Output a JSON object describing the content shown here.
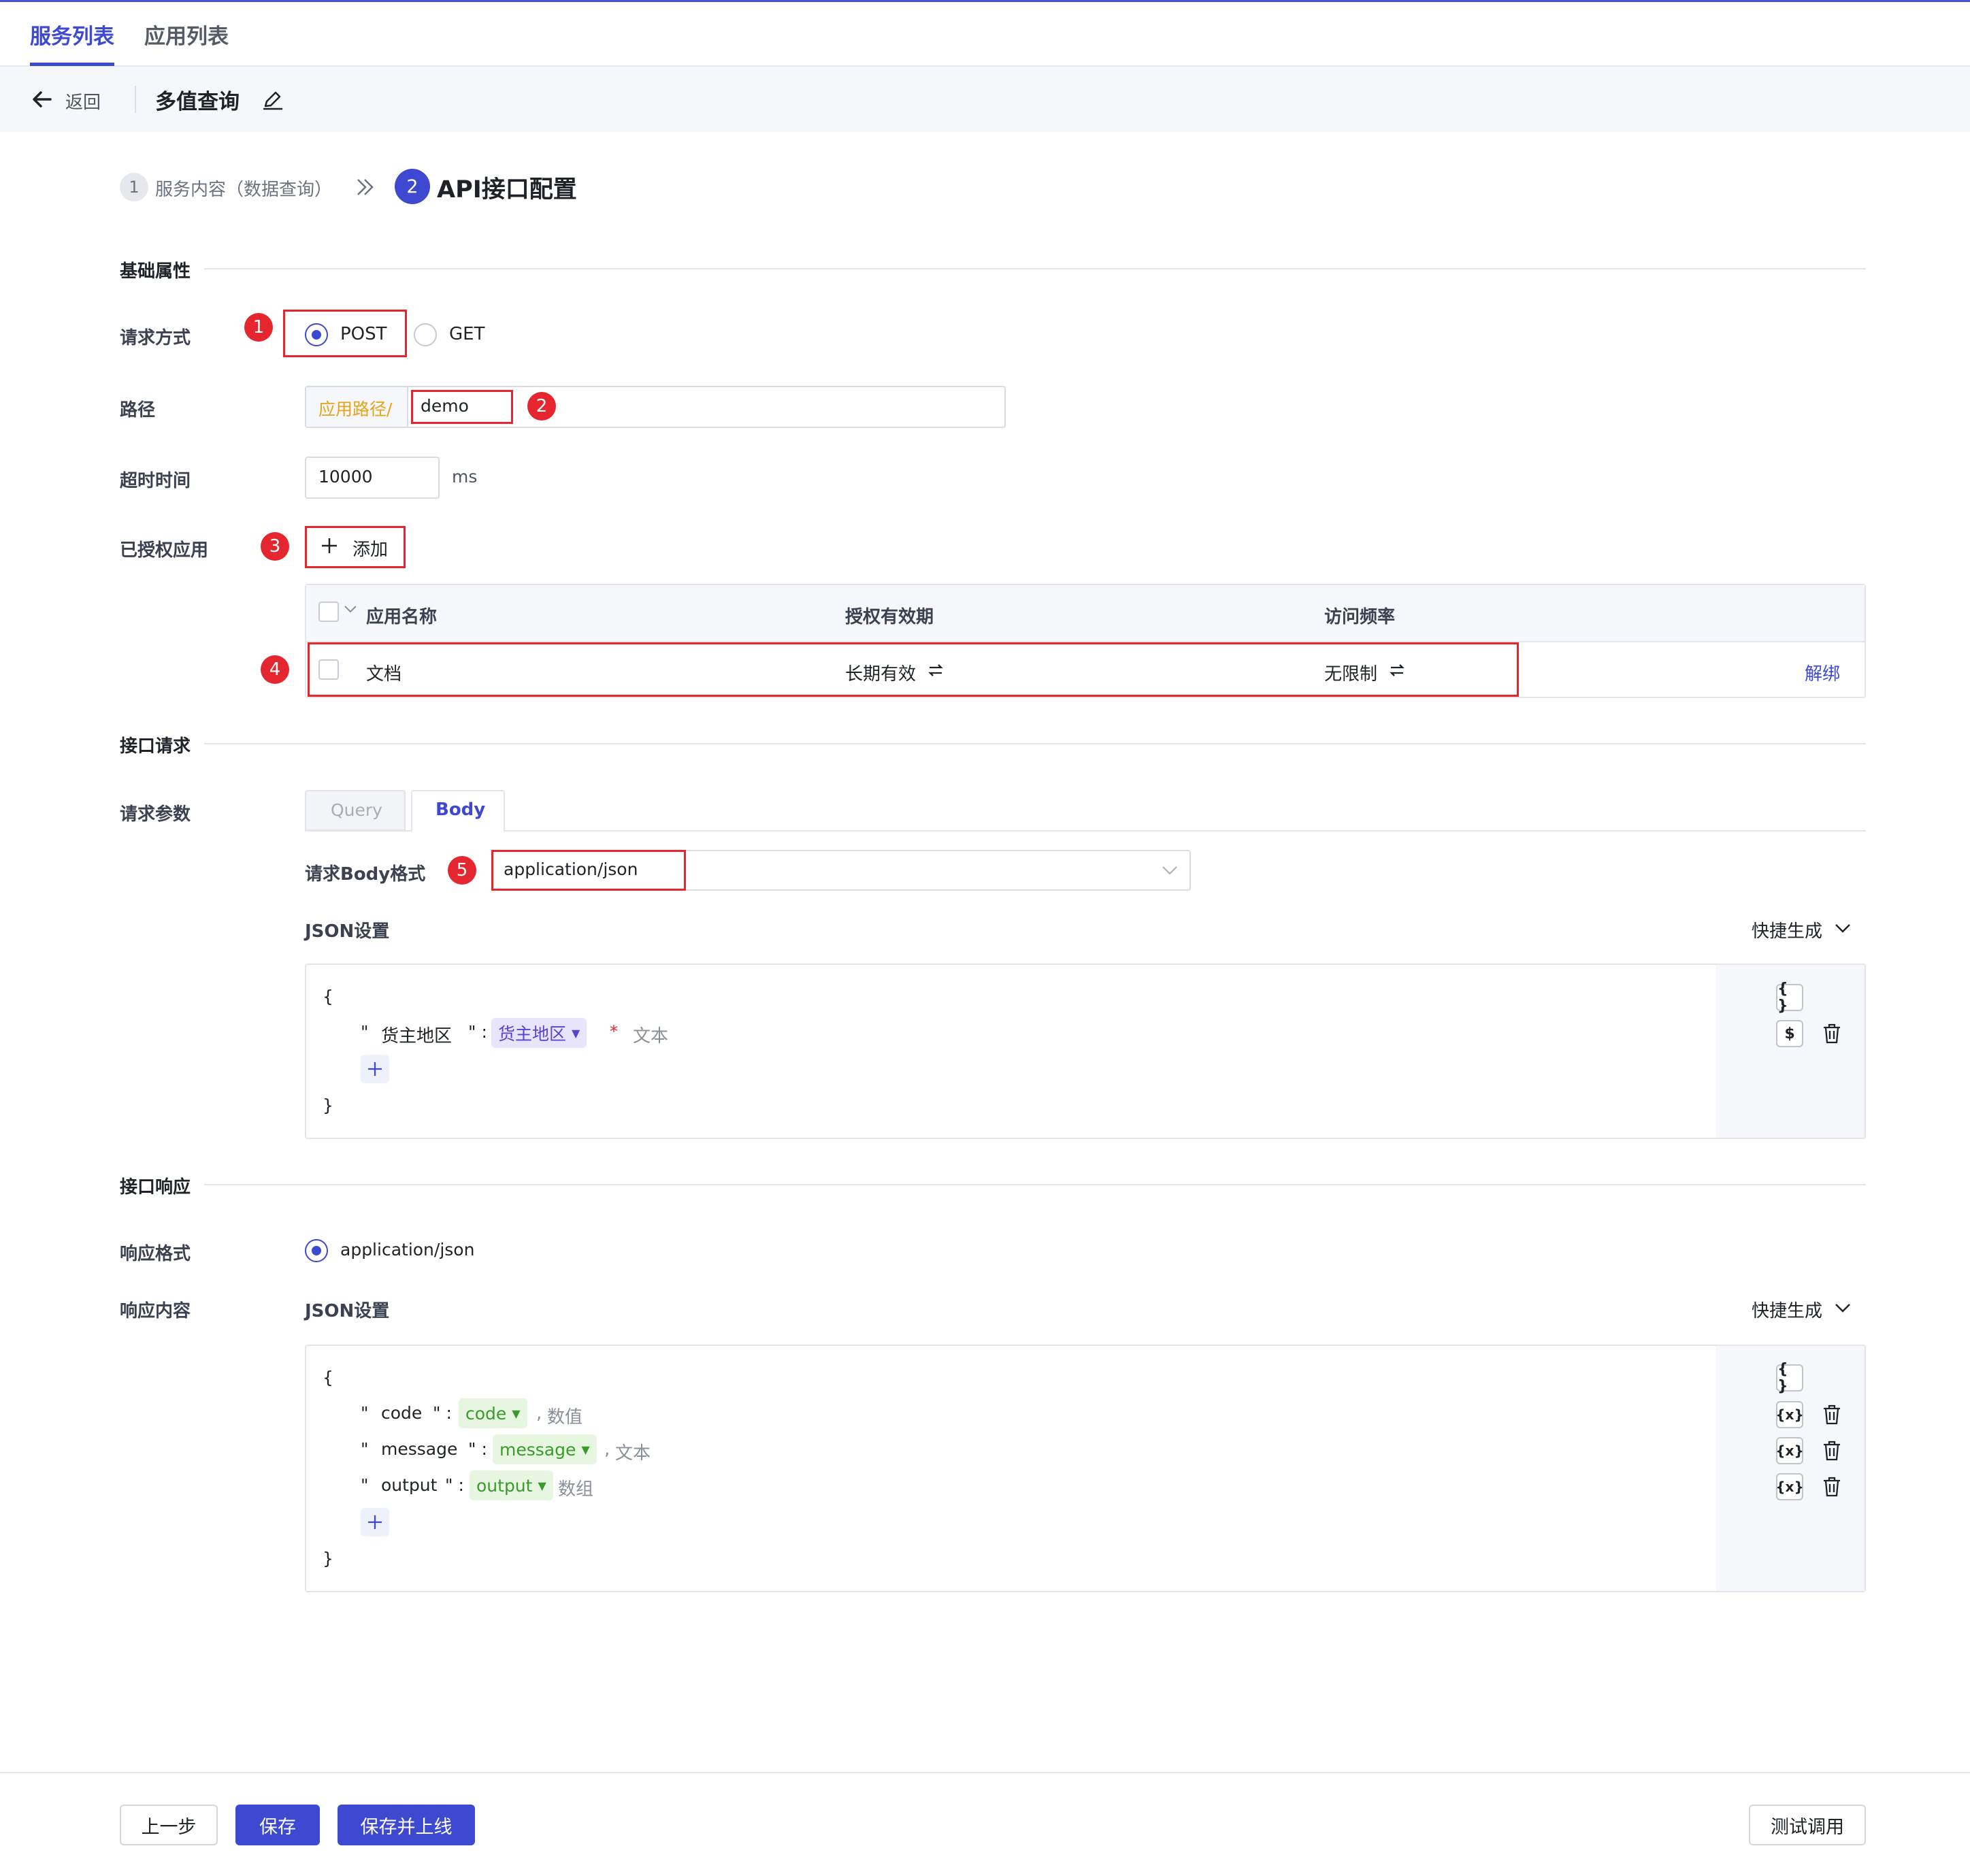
{
  "tabs": [
    {
      "label": "服务列表"
    },
    {
      "label": "应用列表"
    }
  ],
  "header": {
    "back_label": "返回",
    "title": "多值查询"
  },
  "steps": {
    "step1_num": "1",
    "step1_label": "服务内容（数据查询）",
    "step2_num": "2",
    "step2_label": "API接口配置"
  },
  "annotations": [
    "1",
    "2",
    "3",
    "4",
    "5"
  ],
  "basic": {
    "section": "基础属性",
    "method_label": "请求方式",
    "method_options": [
      "POST",
      "GET"
    ],
    "path_label": "路径",
    "path_prefix": "应用路径/",
    "path_value": "demo",
    "timeout_label": "超时时间",
    "timeout_value": "10000",
    "timeout_unit": "ms",
    "authorized_label": "已授权应用",
    "add_label": "添加"
  },
  "apps_table": {
    "columns": [
      "应用名称",
      "授权有效期",
      "访问频率"
    ],
    "rows": [
      {
        "name": "文档",
        "period": "长期有效",
        "rate": "无限制",
        "action": "解绑"
      }
    ]
  },
  "request": {
    "section": "接口请求",
    "params_label": "请求参数",
    "param_tabs": [
      "Query",
      "Body"
    ],
    "body_format_label": "请求Body格式",
    "body_format_value": "application/json",
    "json_label": "JSON设置",
    "quick_label": "快捷生成",
    "fields": [
      {
        "key": "货主地区",
        "value": "货主地区",
        "required": "*",
        "type": "文本"
      }
    ]
  },
  "response": {
    "section": "接口响应",
    "format_label": "响应格式",
    "format_value": "application/json",
    "content_label": "响应内容",
    "json_label": "JSON设置",
    "quick_label": "快捷生成",
    "fields": [
      {
        "key": "code",
        "value": "code",
        "sep": ",",
        "type": "数值"
      },
      {
        "key": "message",
        "value": "message",
        "sep": ",",
        "type": "文本"
      },
      {
        "key": "output",
        "value": "output",
        "sep": "",
        "type": "数组"
      }
    ]
  },
  "footer": {
    "prev": "上一步",
    "save": "保存",
    "save_online": "保存并上线",
    "test": "测试调用"
  },
  "colors": {
    "primary": "#3d49d1",
    "annotation": "#e5262e",
    "path_prefix": "#e8a317"
  },
  "icons": [
    "arrow-left-icon",
    "edit-icon",
    "double-chevron-icon",
    "plus-icon",
    "swap-icon",
    "chevron-down-icon",
    "braces-icon",
    "dollar-icon",
    "variable-icon",
    "trash-icon",
    "caret-down-icon"
  ]
}
